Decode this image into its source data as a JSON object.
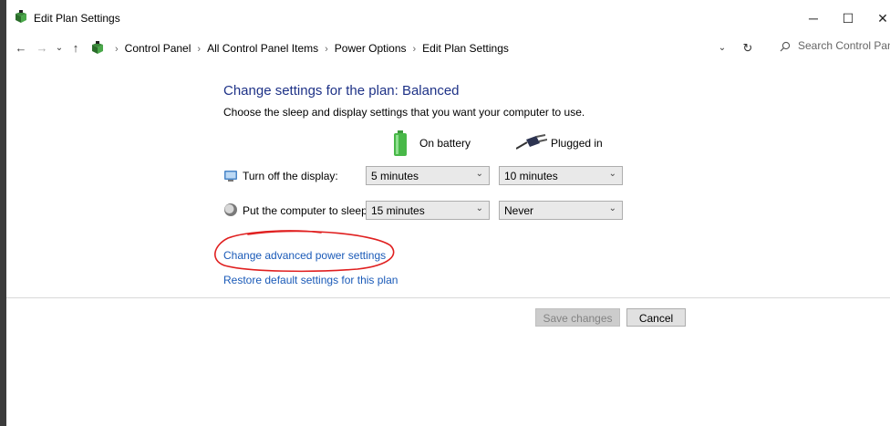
{
  "window": {
    "title": "Edit Plan Settings",
    "controls": {
      "minimize": "─",
      "maximize": "☐",
      "close": "✕"
    }
  },
  "nav": {
    "back": "←",
    "forward": "→",
    "recent": "⌄",
    "up": "↑",
    "breadcrumb": [
      "Control Panel",
      "All Control Panel Items",
      "Power Options",
      "Edit Plan Settings"
    ],
    "dropdown": "⌄",
    "refresh": "↻"
  },
  "search": {
    "placeholder": "Search Control Panel"
  },
  "content": {
    "heading": "Change settings for the plan: Balanced",
    "subtitle": "Choose the sleep and display settings that you want your computer to use.",
    "columns": {
      "battery": "On battery",
      "plugged": "Plugged in"
    },
    "rows": [
      {
        "label": "Turn off the display:",
        "battery": "5 minutes",
        "plugged": "10 minutes",
        "icon": "display-icon"
      },
      {
        "label": "Put the computer to sleep:",
        "battery": "15 minutes",
        "plugged": "Never",
        "icon": "sleep-icon"
      }
    ],
    "links": {
      "advanced": "Change advanced power settings",
      "restore": "Restore default settings for this plan"
    }
  },
  "buttons": {
    "save": "Save changes",
    "cancel": "Cancel"
  },
  "colors": {
    "heading": "#1e3287",
    "link": "#1a5ab8",
    "annotation": "#e02020"
  }
}
